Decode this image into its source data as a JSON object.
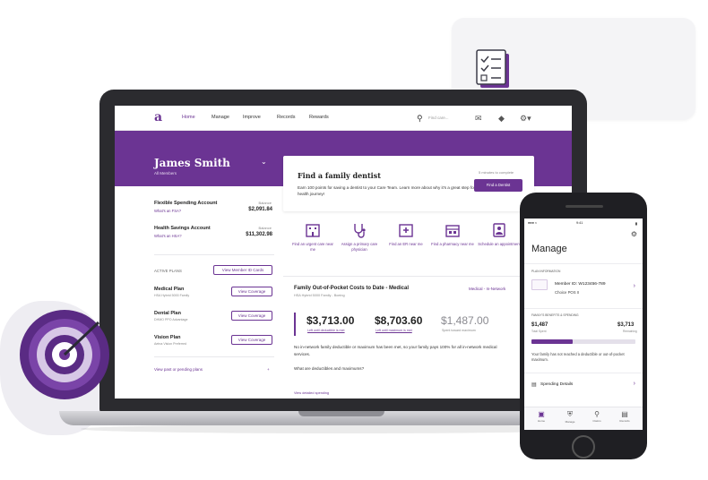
{
  "colors": {
    "accent": "#6b3493",
    "text": "#222222",
    "muted": "#888888"
  },
  "laptop": {
    "nav": {
      "logo": "a",
      "items": [
        "Home",
        "Manage",
        "Improve",
        "Records",
        "Rewards"
      ],
      "search_placeholder": "Find care..."
    },
    "member": {
      "name": "James Smith",
      "subtitle": "All Members"
    },
    "accounts": [
      {
        "name": "Flexible Spending Account",
        "link": "What's an FSA?",
        "balance_label": "Balance",
        "balance": "$2,091.84"
      },
      {
        "name": "Health Savings Account",
        "link": "What's an HSA?",
        "balance_label": "Balance",
        "balance": "$11,302.98"
      }
    ],
    "plans": {
      "title": "ACTIVE PLANS",
      "id_button": "View Member ID Cards",
      "items": [
        {
          "name": "Medical Plan",
          "sub": "HSA Hybrid 5000 Family",
          "button": "View Coverage"
        },
        {
          "name": "Dental Plan",
          "sub": "DHMO PPO Advantage",
          "button": "View Coverage"
        },
        {
          "name": "Vision Plan",
          "sub": "Aetna Vision Preferred",
          "button": "View Coverage"
        }
      ],
      "past_link": "View past or pending plans",
      "past_plus": "+"
    },
    "promo": {
      "title": "Find a family dentist",
      "body": "Earn 100 points for saving a dentist to your Care Team. Learn more about why it's a great step for your health journey!",
      "time": "5 minutes to complete",
      "button": "Find a Dentist"
    },
    "quick_actions": [
      {
        "label": "Find an urgent care near me",
        "icon": "building-icon"
      },
      {
        "label": "Assign a primary care physician",
        "icon": "stethoscope-icon"
      },
      {
        "label": "Find an ER near me",
        "icon": "hospital-icon"
      },
      {
        "label": "Find a pharmacy near me",
        "icon": "pharmacy-icon"
      },
      {
        "label": "Schedule an appointment",
        "icon": "calendar-icon"
      }
    ],
    "costs": {
      "title": "Family Out-of-Pocket Costs to Date - Medical",
      "sub": "HSA Hybrid 5000 Family - Boeing",
      "network": "Medical - In-Network",
      "amounts": [
        {
          "value": "$3,713.00",
          "label": "Left until deductible is met"
        },
        {
          "value": "$8,703.60",
          "label": "Left until maximum is met"
        },
        {
          "value": "$1,487.00",
          "label": "Spent toward maximum"
        }
      ],
      "text": "No in-network family deductible or maximum has been met, so your family pays 100% for all in-network medical services.",
      "question": "What are deductibles and maximums?",
      "link": "View detailed spending"
    }
  },
  "phone": {
    "status_left": "●●● ≈",
    "status_time": "9:41",
    "status_right": "▮",
    "title": "Manage",
    "plan_section": "PLAN INFORMATION",
    "member_id": "Member ID: W123456-789",
    "plan_name": "Choice POS II",
    "benefits_section": "FAMILY'S BENEFITS & SPENDING",
    "spent": {
      "value": "$1,487",
      "label": "Total Spent"
    },
    "remaining": {
      "value": "$3,713",
      "label": "Remaining"
    },
    "spent_fraction": 0.4,
    "note": "Your family has not reached a deductible or out-of-pocket maximum.",
    "spending_details": "Spending Details",
    "tabs": [
      {
        "label": "Home",
        "icon": "home-icon"
      },
      {
        "label": "Manage",
        "icon": "shield-icon"
      },
      {
        "label": "Claims",
        "icon": "claims-icon"
      },
      {
        "label": "Records",
        "icon": "records-icon"
      }
    ]
  }
}
